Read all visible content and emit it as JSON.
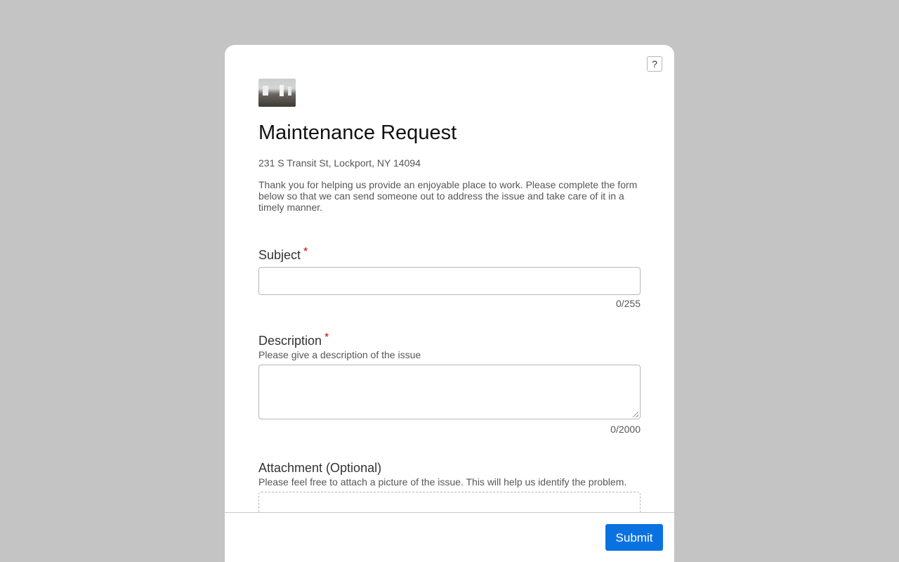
{
  "help": {
    "label": "?"
  },
  "form": {
    "title": "Maintenance Request",
    "address": "231 S Transit St, Lockport, NY 14094",
    "intro": "Thank you for helping us provide an enjoyable place to work. Please complete the form below so that we can send someone out to address the issue and take care of it in a timely manner.",
    "required_marker": "*",
    "fields": {
      "subject": {
        "label": "Subject",
        "value": "",
        "counter": "0/255"
      },
      "description": {
        "label": "Description",
        "hint": "Please give a description of the issue",
        "value": "",
        "counter": "0/2000"
      },
      "attachment": {
        "label": "Attachment (Optional)",
        "hint": "Please feel free to attach a picture of the issue. This will help us identify the problem."
      }
    }
  },
  "footer": {
    "submit_label": "Submit"
  },
  "colors": {
    "page_background": "#c4c4c4",
    "card_background": "#ffffff",
    "primary_button": "#0a72e0",
    "required_marker": "#cc0000"
  }
}
